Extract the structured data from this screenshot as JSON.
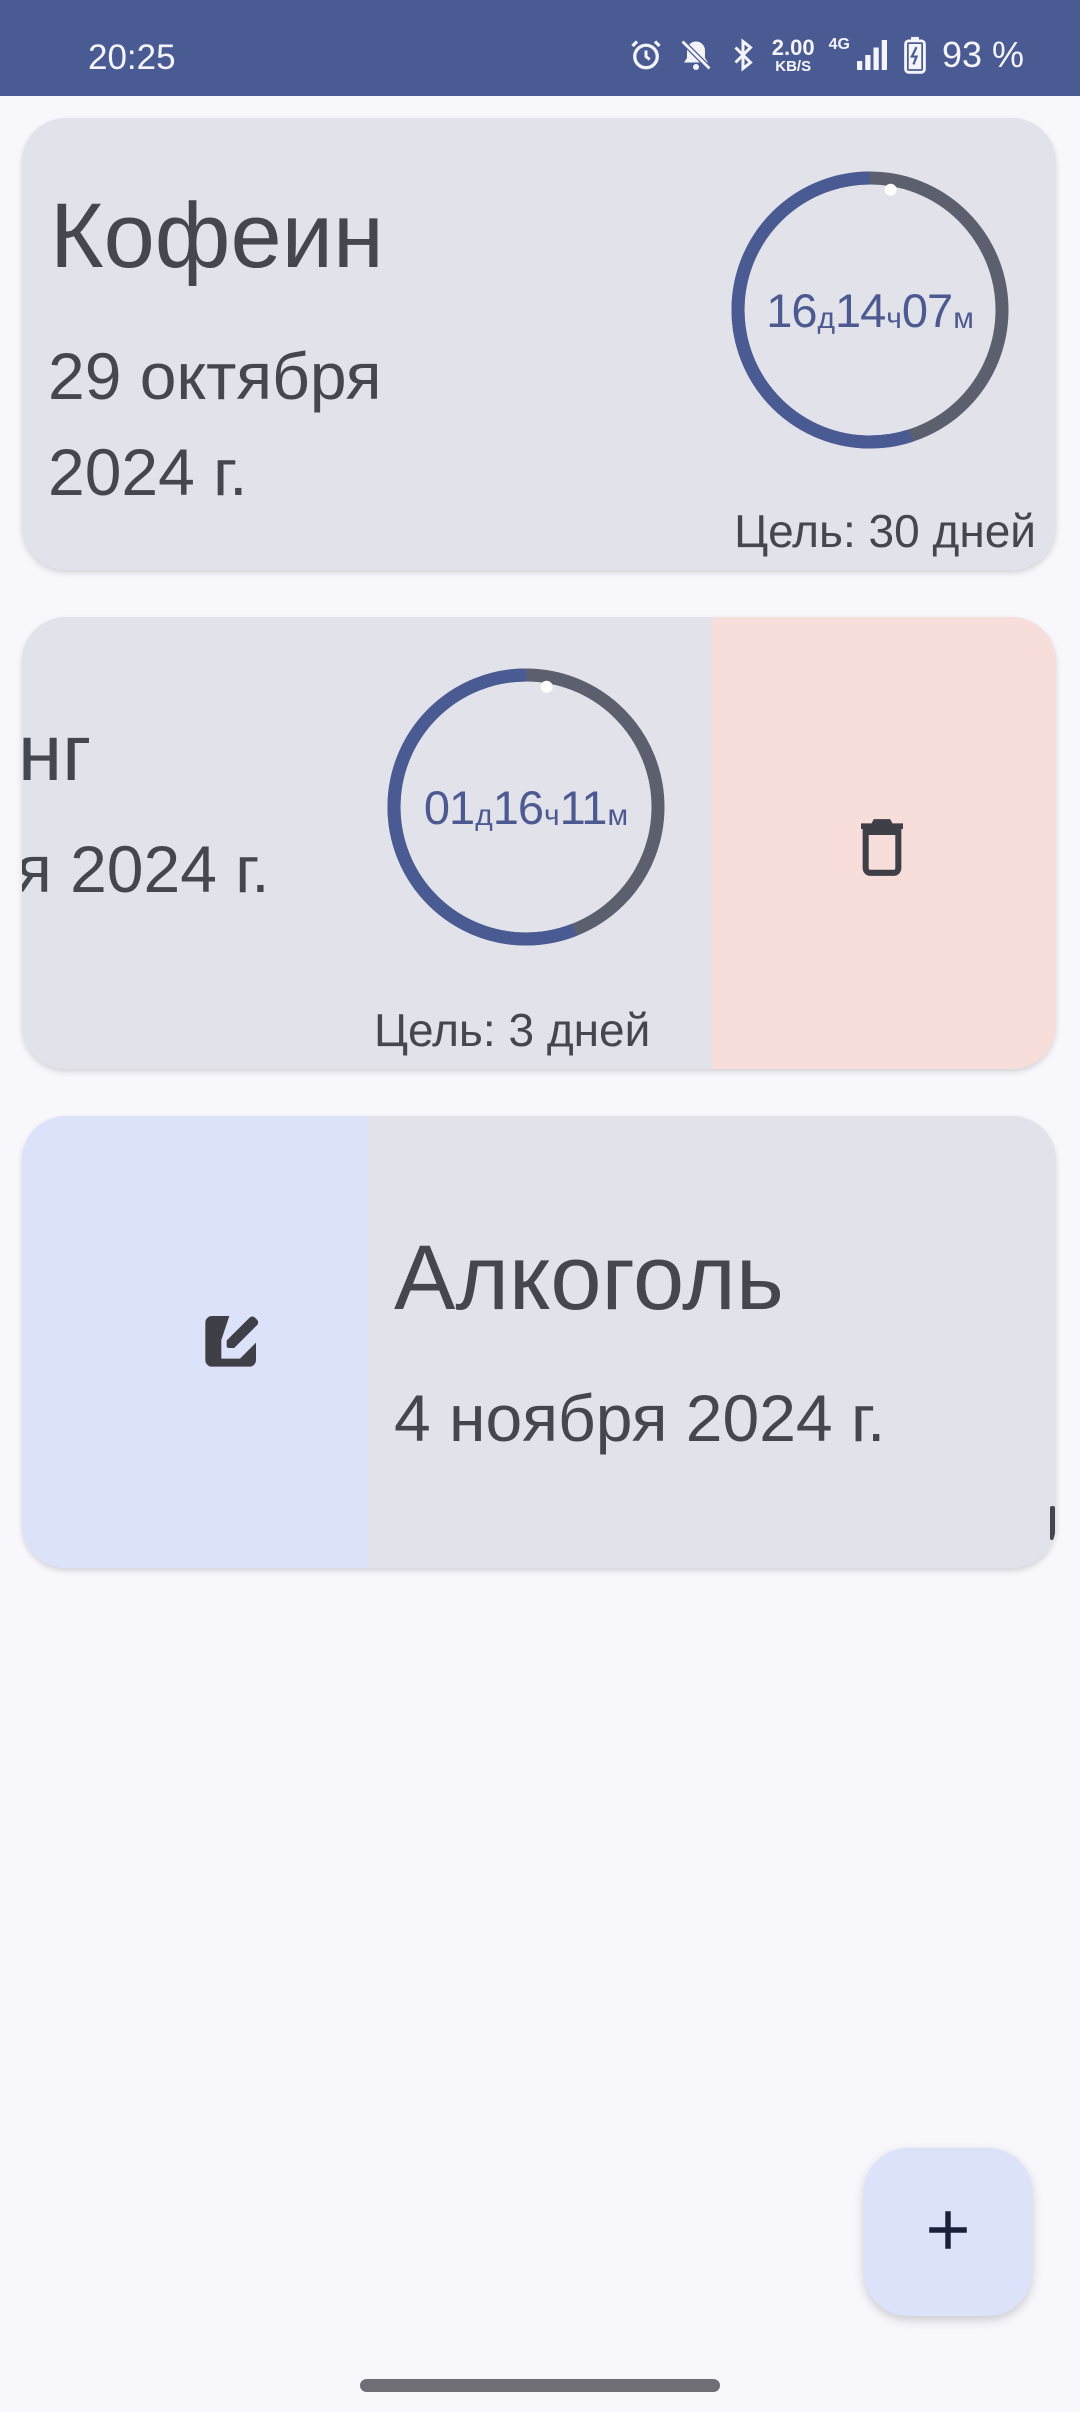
{
  "status_bar": {
    "time": "20:25",
    "net_speed_value": "2.00",
    "net_speed_unit": "KB/S",
    "network_type": "4G",
    "battery_percent": "93 %",
    "icons": [
      "alarm-icon",
      "bell-off-icon",
      "bluetooth-icon",
      "signal-icon",
      "battery-icon"
    ]
  },
  "cards": [
    {
      "title": "Кофеин",
      "date_line1": "29 октября",
      "date_line2": "2024 г.",
      "timer": {
        "days": "16",
        "day_unit": "д",
        "hours": "14",
        "hour_unit": "ч",
        "minutes": "07",
        "minute_unit": "м"
      },
      "progress": 0.55,
      "goal": "Цель: 30 дней"
    },
    {
      "title": "нг",
      "date": "я 2024 г.",
      "timer": {
        "days": "01",
        "day_unit": "д",
        "hours": "16",
        "hour_unit": "ч",
        "minutes": "11",
        "minute_unit": "м"
      },
      "progress": 0.56,
      "goal": "Цель: 3 дней",
      "swipe_action": "delete"
    },
    {
      "title": "Алкоголь",
      "date": "4 ноября 2024 г.",
      "swipe_action": "edit"
    }
  ],
  "fab": {
    "label": "+"
  },
  "colors": {
    "status_bar": "#4a5b93",
    "card": "#e2e2ea",
    "ring_progress": "#4a5b93",
    "ring_track": "#5c5f6e",
    "delete_bg": "#f8dedb",
    "edit_bg": "#dce2f9",
    "fab_bg": "#dce2f9"
  }
}
